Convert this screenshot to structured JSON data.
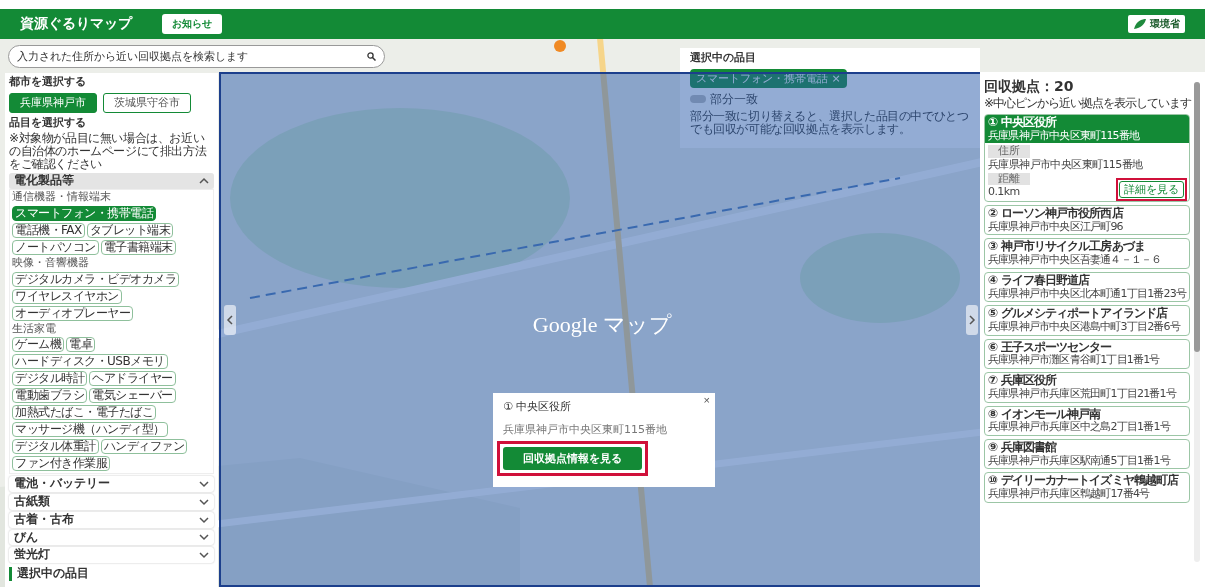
{
  "header": {
    "title": "資源ぐるりマップ",
    "notice_button": "お知らせ",
    "logo_label": "環境省"
  },
  "search": {
    "placeholder": "入力された住所から近い回収拠点を検索します"
  },
  "left_panel": {
    "city_heading": "都市を選択する",
    "cities": [
      {
        "label": "兵庫県神戸市",
        "selected": true
      },
      {
        "label": "茨城県守谷市",
        "selected": false
      }
    ],
    "item_heading": "品目を選択する",
    "item_note": "※対象物が品目に無い場合は、お近いの自治体のホームページにて排出方法をご確認ください",
    "categories": [
      {
        "label": "電化製品等",
        "expanded": true,
        "groups": [
          {
            "label": "通信機器・情報端末",
            "items": [
              {
                "label": "スマートフォン・携帯電話",
                "selected": true
              },
              {
                "label": "電話機・FAX",
                "selected": false
              },
              {
                "label": "タブレット端末",
                "selected": false
              },
              {
                "label": "ノートパソコン",
                "selected": false
              },
              {
                "label": "電子書籍端末",
                "selected": false
              }
            ]
          },
          {
            "label": "映像・音響機器",
            "items": [
              {
                "label": "デジタルカメラ・ビデオカメラ",
                "selected": false
              },
              {
                "label": "ワイヤレスイヤホン",
                "selected": false
              },
              {
                "label": "オーディオプレーヤー",
                "selected": false
              }
            ]
          },
          {
            "label": "生活家電",
            "items": [
              {
                "label": "ゲーム機",
                "selected": false
              },
              {
                "label": "電卓",
                "selected": false
              },
              {
                "label": "ハードディスク・USBメモリ",
                "selected": false
              },
              {
                "label": "デジタル時計",
                "selected": false
              },
              {
                "label": "ヘアドライヤー",
                "selected": false
              },
              {
                "label": "電動歯ブラシ",
                "selected": false
              },
              {
                "label": "電気シェーバー",
                "selected": false
              },
              {
                "label": "加熱式たばこ・電子たばこ",
                "selected": false
              },
              {
                "label": "マッサージ機（ハンディ型）",
                "selected": false
              },
              {
                "label": "デジタル体重計",
                "selected": false
              },
              {
                "label": "ハンディファン",
                "selected": false
              },
              {
                "label": "ファン付き作業服",
                "selected": false
              }
            ]
          }
        ]
      },
      {
        "label": "電池・バッテリー",
        "expanded": false
      },
      {
        "label": "古紙類",
        "expanded": false
      },
      {
        "label": "古着・古布",
        "expanded": false
      },
      {
        "label": "びん",
        "expanded": false
      },
      {
        "label": "蛍光灯",
        "expanded": false
      }
    ],
    "selected_heading": "選択中の品目"
  },
  "selection_panel": {
    "heading": "選択中の品目",
    "chips": [
      {
        "label": "スマートフォン・携帯電話",
        "remove": "×"
      }
    ],
    "partial_match": {
      "label": "部分一致",
      "on": false,
      "note": "部分一致に切り替えると、選択した品目の中でひとつでも回収が可能な回収拠点を表示します。"
    }
  },
  "map_overlay": {
    "label": "Google マップ"
  },
  "popup": {
    "title": "① 中央区役所",
    "address": "兵庫県神戸市中央区東町115番地",
    "button": "回収拠点情報を見る",
    "close": "×",
    "highlighted": true
  },
  "results": {
    "title": "回収拠点：20",
    "note": "※中心ピンから近い拠点を表示しています",
    "sites": [
      {
        "name": "① 中央区役所",
        "address": "兵庫県神戸市中央区東町115番地",
        "expanded": true,
        "details": [
          {
            "label": "住所",
            "value": "兵庫県神戸市中央区東町115番地"
          },
          {
            "label": "距離",
            "value": "0.1km"
          }
        ],
        "detail_button": "詳細を見る",
        "highlighted": true
      },
      {
        "name": "② ローソン神戸市役所西店",
        "address": "兵庫県神戸市中央区江戸町96",
        "expanded": false
      },
      {
        "name": "③ 神戸市リサイクル工房あづま",
        "address": "兵庫県神戸市中央区吾妻通４－１－６",
        "expanded": false
      },
      {
        "name": "④ ライフ春日野道店",
        "address": "兵庫県神戸市中央区北本町通1丁目1番23号",
        "expanded": false
      },
      {
        "name": "⑤ グルメシティポートアイランド店",
        "address": "兵庫県神戸市中央区港島中町3丁目2番6号",
        "expanded": false
      },
      {
        "name": "⑥ 王子スポーツセンター",
        "address": "兵庫県神戸市灘区青谷町1丁目1番1号",
        "expanded": false
      },
      {
        "name": "⑦ 兵庫区役所",
        "address": "兵庫県神戸市兵庫区荒田町1丁目21番1号",
        "expanded": false
      },
      {
        "name": "⑧ イオンモール神戸南",
        "address": "兵庫県神戸市兵庫区中之島2丁目1番1号",
        "expanded": false
      },
      {
        "name": "⑨ 兵庫図書館",
        "address": "兵庫県神戸市兵庫区駅南通5丁目1番1号",
        "expanded": false
      },
      {
        "name": "⑩ デイリーカナートイズミヤ鵯越町店",
        "address": "兵庫県神戸市兵庫区鵯越町17番4号",
        "expanded": false
      }
    ]
  }
}
